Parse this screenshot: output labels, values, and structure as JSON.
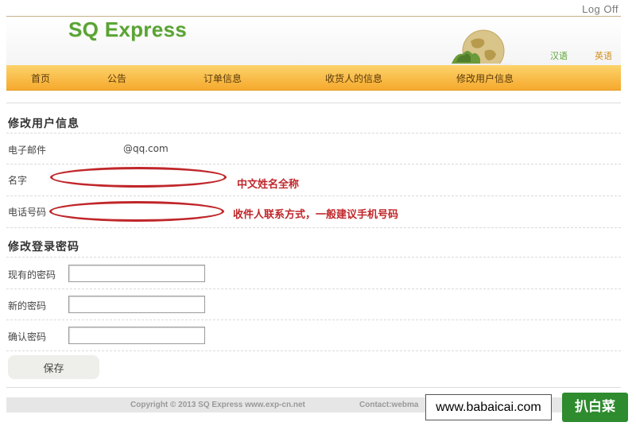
{
  "header": {
    "logout": "Log Off",
    "logo": "SQ Express",
    "lang_cn": "汉语",
    "lang_en": "英语"
  },
  "nav": {
    "items": [
      {
        "label": "首页"
      },
      {
        "label": "公告"
      },
      {
        "label": "订单信息"
      },
      {
        "label": "收货人的信息"
      },
      {
        "label": "修改用户信息"
      }
    ]
  },
  "profile": {
    "title": "修改用户信息",
    "email_label": "电子邮件",
    "email_value": "@qq.com",
    "name_label": "名字",
    "name_note": "中文姓名全称",
    "phone_label": "电话号码",
    "phone_note": "收件人联系方式，一般建议手机号码"
  },
  "password": {
    "title": "修改登录密码",
    "current_label": "现有的密码",
    "new_label": "新的密码",
    "confirm_label": "确认密码",
    "save_label": "保存"
  },
  "footer": {
    "copyright": "Copyright © 2013 SQ Express www.exp-cn.net",
    "contact": "Contact:webma"
  },
  "watermark": {
    "site": "www.babaicai.com",
    "brand": "扒白菜"
  },
  "colors": {
    "accent_green": "#5aa334",
    "nav_orange": "#f6a92d",
    "annotation_red": "#c0262a"
  }
}
